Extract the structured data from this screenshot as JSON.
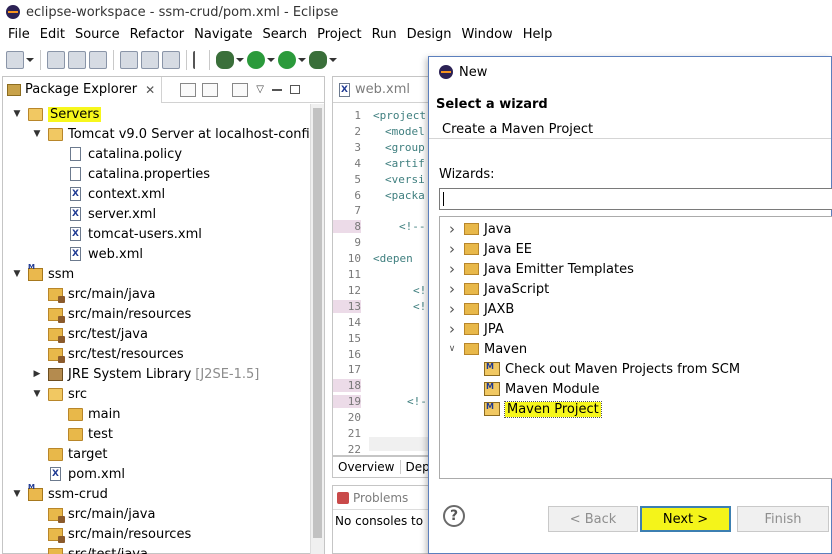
{
  "window": {
    "title": "eclipse-workspace - ssm-crud/pom.xml - Eclipse"
  },
  "menu": [
    "File",
    "Edit",
    "Source",
    "Refactor",
    "Navigate",
    "Search",
    "Project",
    "Run",
    "Design",
    "Window",
    "Help"
  ],
  "package_explorer": {
    "tab_label": "Package Explorer",
    "tree": [
      {
        "label": "Servers",
        "indent": 0,
        "twisty": "open",
        "icon": "folder-open",
        "highlight": true
      },
      {
        "label": "Tomcat v9.0 Server at localhost-config",
        "indent": 1,
        "twisty": "open",
        "icon": "folder-open"
      },
      {
        "label": "catalina.policy",
        "indent": 2,
        "twisty": "",
        "icon": "file"
      },
      {
        "label": "catalina.properties",
        "indent": 2,
        "twisty": "",
        "icon": "file"
      },
      {
        "label": "context.xml",
        "indent": 2,
        "twisty": "",
        "icon": "xml"
      },
      {
        "label": "server.xml",
        "indent": 2,
        "twisty": "",
        "icon": "xml"
      },
      {
        "label": "tomcat-users.xml",
        "indent": 2,
        "twisty": "",
        "icon": "xml"
      },
      {
        "label": "web.xml",
        "indent": 2,
        "twisty": "",
        "icon": "xml"
      },
      {
        "label": "ssm",
        "indent": 0,
        "twisty": "open",
        "icon": "project"
      },
      {
        "label": "src/main/java",
        "indent": 1,
        "twisty": "",
        "icon": "pkg"
      },
      {
        "label": "src/main/resources",
        "indent": 1,
        "twisty": "",
        "icon": "pkg"
      },
      {
        "label": "src/test/java",
        "indent": 1,
        "twisty": "",
        "icon": "pkg"
      },
      {
        "label": "src/test/resources",
        "indent": 1,
        "twisty": "",
        "icon": "pkg"
      },
      {
        "label": "JRE System Library",
        "suffix": "[J2SE-1.5]",
        "indent": 1,
        "twisty": "closed",
        "icon": "lib"
      },
      {
        "label": "src",
        "indent": 1,
        "twisty": "open",
        "icon": "folder-open"
      },
      {
        "label": "main",
        "indent": 2,
        "twisty": "",
        "icon": "folder"
      },
      {
        "label": "test",
        "indent": 2,
        "twisty": "",
        "icon": "folder"
      },
      {
        "label": "target",
        "indent": 1,
        "twisty": "",
        "icon": "folder"
      },
      {
        "label": "pom.xml",
        "indent": 1,
        "twisty": "",
        "icon": "xml"
      },
      {
        "label": "ssm-crud",
        "indent": 0,
        "twisty": "open",
        "icon": "project"
      },
      {
        "label": "src/main/java",
        "indent": 1,
        "twisty": "",
        "icon": "pkg"
      },
      {
        "label": "src/main/resources",
        "indent": 1,
        "twisty": "",
        "icon": "pkg"
      },
      {
        "label": "src/test/java",
        "indent": 1,
        "twisty": "",
        "icon": "pkg"
      }
    ]
  },
  "editor": {
    "tab_label": "web.xml",
    "line_numbers": [
      "1",
      "2",
      "3",
      "4",
      "5",
      "6",
      "7",
      "8",
      "9",
      "10",
      "11",
      "12",
      "13",
      "14",
      "15",
      "16",
      "17",
      "18",
      "19",
      "20",
      "21",
      "22"
    ],
    "marked_lines": [
      "8",
      "13",
      "18",
      "19"
    ],
    "code_lines": [
      {
        "line": "1",
        "text": "<project"
      },
      {
        "line": "2",
        "text": "<model"
      },
      {
        "line": "3",
        "text": "<group"
      },
      {
        "line": "4",
        "text": "<artif"
      },
      {
        "line": "5",
        "text": "<versi"
      },
      {
        "line": "6",
        "text": "<packa"
      },
      {
        "line": "8",
        "text": "<!--"
      },
      {
        "line": "10",
        "text": "<depen"
      },
      {
        "line": "12",
        "text": "<!"
      },
      {
        "line": "13",
        "text": "<!"
      },
      {
        "line": "19",
        "text": "<!-"
      }
    ]
  },
  "bottom_tabs": [
    "Overview",
    "Depe"
  ],
  "problems": {
    "tab_label": "Problems",
    "content": "No consoles to"
  },
  "dialog": {
    "title": "New",
    "heading": "Select a wizard",
    "subheading": "Create a Maven Project",
    "wizards_label": "Wizards:",
    "filter_value": "",
    "tree": [
      {
        "label": "Java",
        "indent": 0,
        "twisty": "closed",
        "icon": "folder"
      },
      {
        "label": "Java EE",
        "indent": 0,
        "twisty": "closed",
        "icon": "folder"
      },
      {
        "label": "Java Emitter Templates",
        "indent": 0,
        "twisty": "closed",
        "icon": "folder"
      },
      {
        "label": "JavaScript",
        "indent": 0,
        "twisty": "closed",
        "icon": "folder"
      },
      {
        "label": "JAXB",
        "indent": 0,
        "twisty": "closed",
        "icon": "folder"
      },
      {
        "label": "JPA",
        "indent": 0,
        "twisty": "closed",
        "icon": "folder"
      },
      {
        "label": "Maven",
        "indent": 0,
        "twisty": "open",
        "icon": "folder"
      },
      {
        "label": "Check out Maven Projects from SCM",
        "indent": 1,
        "twisty": "",
        "icon": "maven"
      },
      {
        "label": "Maven Module",
        "indent": 1,
        "twisty": "",
        "icon": "maven"
      },
      {
        "label": "Maven Project",
        "indent": 1,
        "twisty": "",
        "icon": "maven",
        "highlight": true
      }
    ],
    "buttons": {
      "back": "< Back",
      "next": "Next >",
      "finish": "Finish"
    },
    "help_icon": "?"
  },
  "colors": {
    "highlight": "#f7f71c",
    "selection_border": "#3c7fb1"
  }
}
